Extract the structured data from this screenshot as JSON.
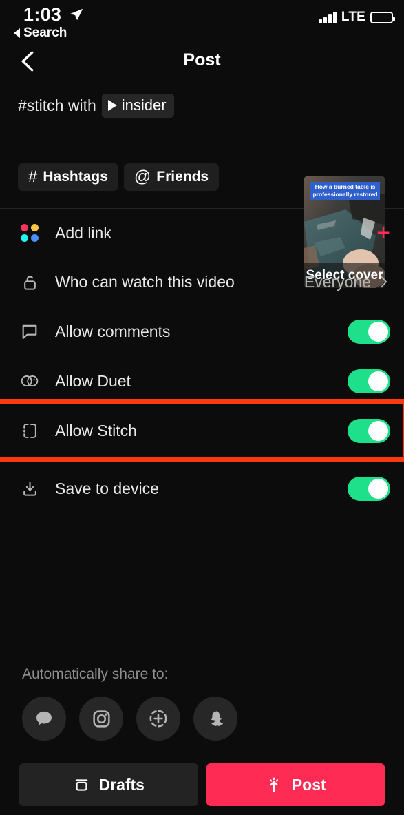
{
  "status_bar": {
    "time": "1:03",
    "location_icon": "location-arrow-icon",
    "back_label": "Search",
    "network": "LTE",
    "signal_icon": "signal-bars-icon",
    "battery_icon": "battery-icon"
  },
  "navbar": {
    "back_icon": "chevron-left-icon",
    "title": "Post"
  },
  "caption": {
    "text": "#stitch with",
    "mention": "insider",
    "mention_icon": "play-triangle-icon",
    "chips": [
      {
        "label": "Hashtags",
        "glyph": "#",
        "icon": "hashtag-icon"
      },
      {
        "label": "Friends",
        "glyph": "@",
        "icon": "at-mention-icon"
      }
    ]
  },
  "cover": {
    "overlay_caption": "How a burned table is professionally restored",
    "select_label": "Select cover",
    "overlay_color": "#2f5fca"
  },
  "settings": [
    {
      "label": "Add link",
      "icon": "four-dots-icon",
      "control": "plus",
      "control_label": "+",
      "dot_colors": [
        "#f5365c",
        "#ffc83c",
        "#25f4ee",
        "#4a8ff7"
      ]
    },
    {
      "label": "Who can watch this video",
      "icon": "unlocked-padlock-icon",
      "control": "value",
      "value": "Everyone",
      "chevron_icon": "chevron-right-icon"
    },
    {
      "label": "Allow comments",
      "icon": "comment-bubble-icon",
      "control": "toggle",
      "toggle_on": true
    },
    {
      "label": "Allow Duet",
      "icon": "duet-circles-icon",
      "control": "toggle",
      "toggle_on": true
    },
    {
      "label": "Allow Stitch",
      "icon": "stitch-frame-icon",
      "control": "toggle",
      "toggle_on": true,
      "highlighted": true
    },
    {
      "label": "Save to device",
      "icon": "download-icon",
      "control": "toggle",
      "toggle_on": true
    }
  ],
  "share": {
    "label": "Automatically share to:",
    "targets": [
      {
        "name": "messages-icon"
      },
      {
        "name": "instagram-icon"
      },
      {
        "name": "instagram-story-icon"
      },
      {
        "name": "snapchat-icon"
      }
    ]
  },
  "bottom_bar": {
    "drafts_label": "Drafts",
    "drafts_icon": "archive-box-icon",
    "post_label": "Post",
    "post_icon": "upload-sparkle-icon"
  },
  "colors": {
    "accent_pink": "#fe2c55",
    "toggle_green": "#1ee08a",
    "highlight_red": "#fb3a0f",
    "background": "#0c0c0c"
  }
}
